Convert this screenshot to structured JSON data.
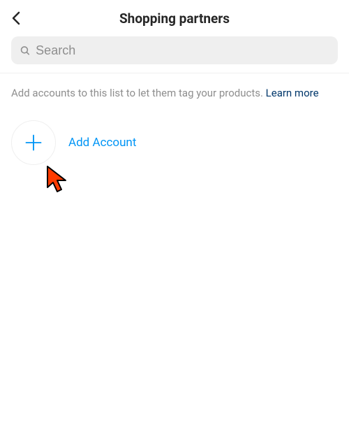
{
  "header": {
    "title": "Shopping partners"
  },
  "search": {
    "placeholder": "Search"
  },
  "info": {
    "text": "Add accounts to this list to let them tag your products. ",
    "learn_more": "Learn more"
  },
  "add": {
    "label": "Add Account"
  },
  "icons": {
    "back": "chevron-left-icon",
    "search": "magnifier-icon",
    "plus": "plus-icon",
    "cursor": "cursor-pointer-icon"
  },
  "colors": {
    "accent": "#0095f6",
    "link": "#00376b",
    "muted": "#8e8e8e",
    "field_bg": "#efefef"
  }
}
